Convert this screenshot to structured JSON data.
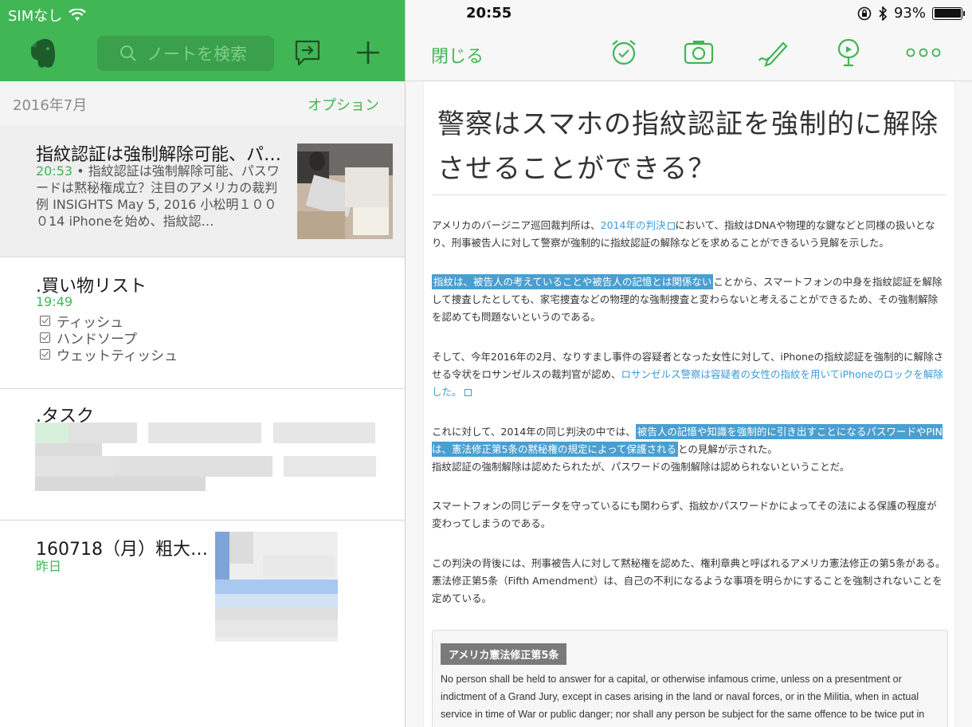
{
  "status": {
    "carrier": "SIMなし",
    "time": "20:55",
    "battery": "93%"
  },
  "left": {
    "search_placeholder": "ノートを検索",
    "month": "2016年7月",
    "options": "オプション",
    "notes": [
      {
        "title": "指紋認証は強制解除可能、パ…",
        "time": "20:53",
        "snippet": "指紋認証は強制解除可能、パスワードは黙秘権成立？注目のアメリカの裁判例 INSIGHTS May 5, 2016 小松明１０００14 iPhoneを始め、指紋認…"
      },
      {
        "title": ".買い物リスト",
        "time": "19:49",
        "items": [
          "ティッシュ",
          "ハンドソープ",
          "ウェットティッシュ"
        ]
      },
      {
        "title": ".タスク"
      },
      {
        "title": "160718（月）粗大…",
        "time": "昨日"
      }
    ]
  },
  "right": {
    "close_label": "閉じる",
    "doc_title": "警察はスマホの指紋認証を強制的に解除させることができる？",
    "p1_a": "アメリカのバージニア巡回裁判所は、",
    "p1_link": "2014年の判決",
    "p1_b": "において、指紋はDNAや物理的な鍵などと同様の扱いとなり、刑事被告人に対して警察が強制的に指紋認証の解除などを求めることができるいう見解を示した。",
    "p2_hl": "指紋は、被告人の考えていることや被告人の記憶とは関係ない",
    "p2_b": "ことから、スマートフォンの中身を指紋認証を解除して捜査したとしても、家宅捜査などの物理的な強制捜査と変わらないと考えることができるため、その強制解除を認めても問題ないというのである。",
    "p3_a": "そして、今年2016年の2月、なりすまし事件の容疑者となった女性に対して、iPhoneの指紋認証を強制的に解除させる令状をロサンゼルスの裁判官が認め、",
    "p3_link": "ロサンゼルス警察は容疑者の女性の指紋を用いてiPhoneのロックを解除した。",
    "p4_a": "これに対して、2014年の同じ判決の中では、",
    "p4_hl": "被告人の記憶や知識を強制的に引き出すことになるパスワードやPINは、憲法修正第5条の黙秘権の規定によって保護される",
    "p4_b": "との見解が示された。",
    "p4_c": "指紋認証の強制解除は認めたられたが、パスワードの強制解除は認められないということだ。",
    "p5": "スマートフォンの同じデータを守っているにも関わらず、指紋かパスワードかによってその法による保護の程度が変わってしまうのである。",
    "p6": "この判決の背後には、刑事被告人に対して黙秘権を認めた、権利章典と呼ばれるアメリカ憲法修正の第5条がある。憲法修正第5条（Fifth Amendment）は、自己の不利になるような事項を明らかにすることを強制されないことを定めている。",
    "box_title": "アメリカ憲法修正第5条",
    "box_text": "No person shall be held to answer for a capital, or otherwise infamous crime, unless on a presentment or indictment of a Grand Jury, except in cases arising in the land or naval forces, or in the Militia, when in actual service in time of War or public danger; nor shall any person be subject for the same offence to be twice put in"
  },
  "colors": {
    "accent": "#41b655",
    "highlight": "#4a9fd1",
    "link": "#3d9bd6"
  }
}
